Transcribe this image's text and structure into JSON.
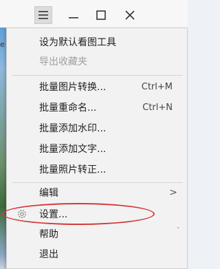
{
  "titlebar": {
    "icons": [
      "menu-icon",
      "minimize-icon",
      "maximize-icon",
      "close-icon"
    ]
  },
  "background": {
    "left_char": "e"
  },
  "menu": {
    "set_default": "设为默认看图工具",
    "export_favorites": "导出收藏夹",
    "batch_convert": "批量图片转换...",
    "batch_convert_shortcut": "Ctrl+M",
    "batch_rename": "批量重命名...",
    "batch_rename_shortcut": "Ctrl+N",
    "batch_watermark": "批量添加水印...",
    "batch_text": "批量添加文字...",
    "batch_rotate": "批量照片转正...",
    "edit": "编辑",
    "settings": "设置...",
    "help": "帮助",
    "exit": "退出",
    "submenu_arrow": ">",
    "help_mark": "`"
  },
  "colors": {
    "highlight_ellipse": "#d33a3a",
    "menu_bg": "#f2f2f2"
  }
}
